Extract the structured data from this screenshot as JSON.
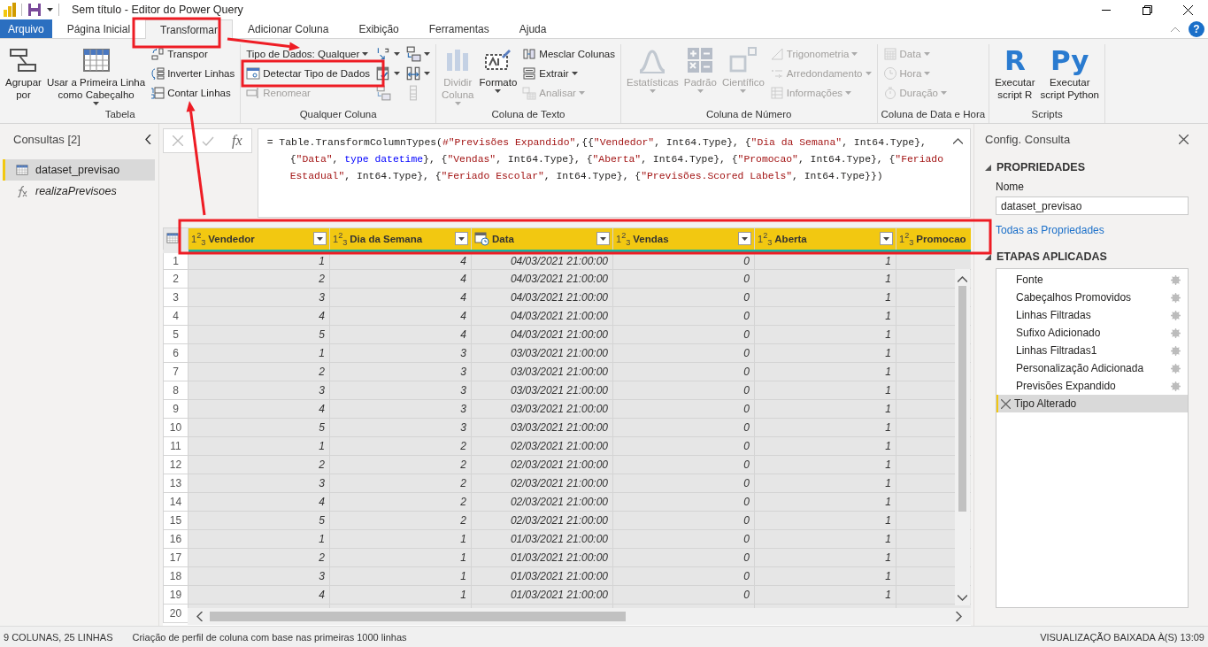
{
  "window": {
    "title": "Sem título - Editor do Power Query"
  },
  "tabs": [
    {
      "label": "Arquivo",
      "kind": "file",
      "selected": false
    },
    {
      "label": "Página Inicial",
      "kind": "tab",
      "selected": false
    },
    {
      "label": "Transformar",
      "kind": "tab",
      "selected": true
    },
    {
      "label": "Adicionar Coluna",
      "kind": "tab",
      "selected": false
    },
    {
      "label": "Exibição",
      "kind": "tab",
      "selected": false
    },
    {
      "label": "Ferramentas",
      "kind": "tab",
      "selected": false
    },
    {
      "label": "Ajuda",
      "kind": "tab",
      "selected": false
    }
  ],
  "help": "?",
  "ribbon": {
    "groups": [
      {
        "label": "Tabela",
        "columns": [
          {
            "items": [
              {
                "kind": "large",
                "lines": [
                  "Agrupar",
                  "por"
                ],
                "disabled": false,
                "dropdown": false
              }
            ]
          },
          {
            "items": [
              {
                "kind": "large",
                "lines": [
                  "Usar a Primeira Linha",
                  "como Cabeçalho"
                ],
                "disabled": false,
                "dropdown": true
              }
            ]
          },
          {
            "items": [
              {
                "kind": "small",
                "label": "Transpor",
                "disabled": false,
                "dropdown": false
              },
              {
                "kind": "small",
                "label": "Inverter Linhas",
                "disabled": false,
                "dropdown": false
              },
              {
                "kind": "small",
                "label": "Contar Linhas",
                "disabled": false,
                "dropdown": false
              }
            ]
          }
        ]
      },
      {
        "label": "Qualquer Coluna",
        "columns": [
          {
            "items": [
              {
                "kind": "small",
                "label": "Tipo de Dados: Qualquer",
                "disabled": false,
                "dropdown": true
              },
              {
                "kind": "small",
                "label": "Detectar Tipo de Dados",
                "disabled": false,
                "dropdown": false
              },
              {
                "kind": "small",
                "label": "Renomear",
                "disabled": true,
                "dropdown": false
              }
            ]
          },
          {
            "items": [
              {
                "kind": "icon",
                "disabled": false,
                "dropdown": true
              },
              {
                "kind": "icon",
                "disabled": false,
                "dropdown": true
              },
              {
                "kind": "icon",
                "disabled": true,
                "dropdown": false
              }
            ]
          },
          {
            "items": [
              {
                "kind": "icon",
                "disabled": false,
                "dropdown": true
              },
              {
                "kind": "icon",
                "disabled": false,
                "dropdown": true
              },
              {
                "kind": "icon",
                "disabled": true,
                "dropdown": false
              }
            ]
          }
        ]
      },
      {
        "label": "Coluna de Texto",
        "columns": [
          {
            "items": [
              {
                "kind": "large",
                "lines": [
                  "Dividir",
                  "Coluna"
                ],
                "disabled": true,
                "dropdown": true
              }
            ]
          },
          {
            "items": [
              {
                "kind": "large",
                "lines": [
                  "Formato"
                ],
                "disabled": false,
                "dropdown": true
              }
            ]
          },
          {
            "items": [
              {
                "kind": "small",
                "label": "Mesclar Colunas",
                "disabled": false,
                "dropdown": false
              },
              {
                "kind": "small",
                "label": "Extrair",
                "disabled": false,
                "dropdown": true
              },
              {
                "kind": "small",
                "label": "Analisar",
                "disabled": true,
                "dropdown": true
              }
            ]
          }
        ]
      },
      {
        "label": "Coluna de Número",
        "columns": [
          {
            "items": [
              {
                "kind": "large",
                "lines": [
                  "Estatísticas"
                ],
                "disabled": true,
                "dropdown": true
              }
            ]
          },
          {
            "items": [
              {
                "kind": "large",
                "lines": [
                  "Padrão"
                ],
                "disabled": true,
                "dropdown": true
              }
            ]
          },
          {
            "items": [
              {
                "kind": "large",
                "lines": [
                  "Científico"
                ],
                "disabled": true,
                "dropdown": true
              }
            ]
          },
          {
            "items": [
              {
                "kind": "small",
                "label": "Trigonometria",
                "disabled": true,
                "dropdown": true
              },
              {
                "kind": "small",
                "label": "Arredondamento",
                "disabled": true,
                "dropdown": true
              },
              {
                "kind": "small",
                "label": "Informações",
                "disabled": true,
                "dropdown": true
              }
            ]
          }
        ]
      },
      {
        "label": "Coluna de Data e Hora",
        "columns": [
          {
            "items": [
              {
                "kind": "small",
                "label": "Data",
                "disabled": true,
                "dropdown": true
              },
              {
                "kind": "small",
                "label": "Hora",
                "disabled": true,
                "dropdown": true
              },
              {
                "kind": "small",
                "label": "Duração",
                "disabled": true,
                "dropdown": true
              }
            ]
          }
        ]
      },
      {
        "label": "Scripts",
        "columns": [
          {
            "items": [
              {
                "kind": "large",
                "glyph": "R",
                "lines": [
                  "Executar",
                  "script R"
                ],
                "disabled": false,
                "dropdown": false
              }
            ]
          },
          {
            "items": [
              {
                "kind": "large",
                "glyph": "Py",
                "lines": [
                  "Executar",
                  "script Python"
                ],
                "disabled": false,
                "dropdown": false
              }
            ]
          }
        ]
      }
    ]
  },
  "queries": {
    "title": "Consultas [2]",
    "items": [
      {
        "name": "dataset_previsao",
        "kind": "table",
        "selected": true
      },
      {
        "name": "realizaPrevisoes",
        "kind": "function",
        "selected": false
      }
    ]
  },
  "formula_bar": {
    "fx": "fx",
    "lines": [
      [
        {
          "kind": "plain",
          "text": "= Table.TransformColumnTypes("
        },
        {
          "kind": "string",
          "text": "#\"Previsões Expandido\""
        },
        {
          "kind": "plain",
          "text": ",{{"
        },
        {
          "kind": "string",
          "text": "\"Vendedor\""
        },
        {
          "kind": "plain",
          "text": ", Int64.Type}, {"
        },
        {
          "kind": "string",
          "text": "\"Dia da Semana\""
        },
        {
          "kind": "plain",
          "text": ", Int64.Type},"
        }
      ],
      [
        {
          "kind": "plain",
          "text": "{"
        },
        {
          "kind": "string",
          "text": "\"Data\""
        },
        {
          "kind": "plain",
          "text": ", "
        },
        {
          "kind": "keyword",
          "text": "type datetime"
        },
        {
          "kind": "plain",
          "text": "}, {"
        },
        {
          "kind": "string",
          "text": "\"Vendas\""
        },
        {
          "kind": "plain",
          "text": ", Int64.Type}, {"
        },
        {
          "kind": "string",
          "text": "\"Aberta\""
        },
        {
          "kind": "plain",
          "text": ", Int64.Type}, {"
        },
        {
          "kind": "string",
          "text": "\"Promocao\""
        },
        {
          "kind": "plain",
          "text": ", Int64.Type}, {"
        },
        {
          "kind": "string",
          "text": "\"Feriado"
        }
      ],
      [
        {
          "kind": "string",
          "text": "Estadual\""
        },
        {
          "kind": "plain",
          "text": ", Int64.Type}, {"
        },
        {
          "kind": "string",
          "text": "\"Feriado Escolar\""
        },
        {
          "kind": "plain",
          "text": ", Int64.Type}, {"
        },
        {
          "kind": "string",
          "text": "\"Previsões.Scored Labels\""
        },
        {
          "kind": "plain",
          "text": ", Int64.Type}})"
        }
      ]
    ]
  },
  "table": {
    "columns": [
      {
        "name": "Vendedor",
        "kind": "number",
        "type_label": "1$^{2}$$_{3}$"
      },
      {
        "name": "Dia da Semana",
        "kind": "number",
        "type_label": "1$^{2}$$_{3}$"
      },
      {
        "name": "Data",
        "kind": "datetime"
      },
      {
        "name": "Vendas",
        "kind": "number",
        "type_label": "1$^{2}$$_{3}$"
      },
      {
        "name": "Aberta",
        "kind": "number",
        "type_label": "1$^{2}$$_{3}$"
      },
      {
        "name": "Promocao",
        "kind": "number",
        "type_label": "1$^{2}$$_{3}$"
      }
    ],
    "rows": [
      {
        "number": "1",
        "cells": [
          "1",
          "4",
          "04/03/2021 21:00:00",
          "0",
          "1"
        ]
      },
      {
        "number": "2",
        "cells": [
          "2",
          "4",
          "04/03/2021 21:00:00",
          "0",
          "1"
        ]
      },
      {
        "number": "3",
        "cells": [
          "3",
          "4",
          "04/03/2021 21:00:00",
          "0",
          "1"
        ]
      },
      {
        "number": "4",
        "cells": [
          "4",
          "4",
          "04/03/2021 21:00:00",
          "0",
          "1"
        ]
      },
      {
        "number": "5",
        "cells": [
          "5",
          "4",
          "04/03/2021 21:00:00",
          "0",
          "1"
        ]
      },
      {
        "number": "6",
        "cells": [
          "1",
          "3",
          "03/03/2021 21:00:00",
          "0",
          "1"
        ]
      },
      {
        "number": "7",
        "cells": [
          "2",
          "3",
          "03/03/2021 21:00:00",
          "0",
          "1"
        ]
      },
      {
        "number": "8",
        "cells": [
          "3",
          "3",
          "03/03/2021 21:00:00",
          "0",
          "1"
        ]
      },
      {
        "number": "9",
        "cells": [
          "4",
          "3",
          "03/03/2021 21:00:00",
          "0",
          "1"
        ]
      },
      {
        "number": "10",
        "cells": [
          "5",
          "3",
          "03/03/2021 21:00:00",
          "0",
          "1"
        ]
      },
      {
        "number": "11",
        "cells": [
          "1",
          "2",
          "02/03/2021 21:00:00",
          "0",
          "1"
        ]
      },
      {
        "number": "12",
        "cells": [
          "2",
          "2",
          "02/03/2021 21:00:00",
          "0",
          "1"
        ]
      },
      {
        "number": "13",
        "cells": [
          "3",
          "2",
          "02/03/2021 21:00:00",
          "0",
          "1"
        ]
      },
      {
        "number": "14",
        "cells": [
          "4",
          "2",
          "02/03/2021 21:00:00",
          "0",
          "1"
        ]
      },
      {
        "number": "15",
        "cells": [
          "5",
          "2",
          "02/03/2021 21:00:00",
          "0",
          "1"
        ]
      },
      {
        "number": "16",
        "cells": [
          "1",
          "1",
          "01/03/2021 21:00:00",
          "0",
          "1"
        ]
      },
      {
        "number": "17",
        "cells": [
          "2",
          "1",
          "01/03/2021 21:00:00",
          "0",
          "1"
        ]
      },
      {
        "number": "18",
        "cells": [
          "3",
          "1",
          "01/03/2021 21:00:00",
          "0",
          "1"
        ]
      },
      {
        "number": "19",
        "cells": [
          "4",
          "1",
          "01/03/2021 21:00:00",
          "0",
          "1"
        ]
      },
      {
        "number": "20",
        "cells": []
      }
    ]
  },
  "settings": {
    "title": "Config. Consulta",
    "properties_header": "PROPRIEDADES",
    "name_label": "Nome",
    "name_value": "dataset_previsao",
    "all_properties_link": "Todas as Propriedades",
    "steps_header": "ETAPAS APLICADAS",
    "steps": [
      {
        "name": "Fonte",
        "selected": false
      },
      {
        "name": "Cabeçalhos Promovidos",
        "selected": false
      },
      {
        "name": "Linhas Filtradas",
        "selected": false
      },
      {
        "name": "Sufixo Adicionado",
        "selected": false
      },
      {
        "name": "Linhas Filtradas1",
        "selected": false
      },
      {
        "name": "Personalização Adicionada",
        "selected": false
      },
      {
        "name": "Previsões Expandido",
        "selected": false
      },
      {
        "name": "Tipo Alterado",
        "selected": true
      }
    ]
  },
  "status_bar": {
    "summary": "9 COLUNAS, 25 LINHAS",
    "profiling": "Criação de perfil de coluna com base nas primeiras 1000 linhas",
    "preview": "VISUALIZAÇÃO BAIXADA À(S) 13:09"
  },
  "annotations": [
    {
      "kind": "box"
    },
    {
      "kind": "box"
    },
    {
      "kind": "box"
    },
    {
      "kind": "arrow"
    },
    {
      "kind": "arrow"
    }
  ]
}
